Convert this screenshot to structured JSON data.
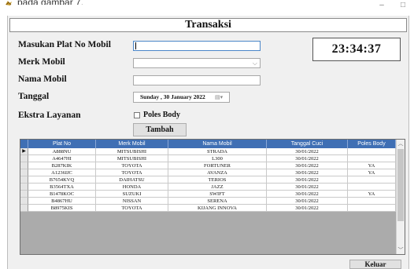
{
  "crop_text": "pada gambar 7.",
  "window_controls": {
    "minimize": "–",
    "maximize": "□"
  },
  "form": {
    "title": "Transaksi",
    "labels": {
      "plat": "Masukan Plat No Mobil",
      "merk": "Merk Mobil",
      "nama": "Nama Mobil",
      "tanggal": "Tanggal",
      "layanan": "Ekstra Layanan"
    },
    "inputs": {
      "plat_value": "",
      "merk_value": "",
      "nama_value": ""
    },
    "date_value": "Sunday   , 30   January   2022",
    "checkbox_label": "Poles Body",
    "checkbox_checked": false,
    "tambah_label": "Tambah",
    "keluar_label": "Keluar",
    "clock": "23:34:37"
  },
  "table": {
    "columns": [
      "Plat No",
      "Merk Mobil",
      "Nama Mobil",
      "Tanggal Cuci",
      "Poles Body"
    ],
    "rows": [
      [
        "A888NU",
        "MITSUBISHI",
        "STRADA",
        "30/01/2022",
        ""
      ],
      [
        "A4647HI",
        "MITSUBISHI",
        "L300",
        "30/01/2022",
        ""
      ],
      [
        "B287KIK",
        "TOYOTA",
        "FORTUNER",
        "30/01/2022",
        "YA"
      ],
      [
        "A1236IJC",
        "TOYOTA",
        "AVANZA",
        "30/01/2022",
        "YA"
      ],
      [
        "B7654KVQ",
        "DAIHATSU",
        "TERIOS",
        "30/01/2022",
        ""
      ],
      [
        "B3564TXA",
        "HONDA",
        "JAZZ",
        "30/01/2022",
        ""
      ],
      [
        "B1478KOC",
        "SUZUKI",
        "SWIFT",
        "30/01/2022",
        "YA"
      ],
      [
        "B4867HU",
        "NISSAN",
        "SERENA",
        "30/01/2022",
        ""
      ],
      [
        "B8975KIS",
        "TOYOTA",
        "KIJANG INNOVA",
        "30/01/2022",
        ""
      ]
    ],
    "current_row_marker": "▶"
  },
  "colors": {
    "header_bg": "#3f6fb4",
    "grid_bg": "#ababab",
    "window_bg": "#f0f0f0"
  },
  "icons": {
    "app": "app-icon",
    "scroll_up": "scroll-up-icon",
    "scroll_down": "scroll-down-icon"
  }
}
